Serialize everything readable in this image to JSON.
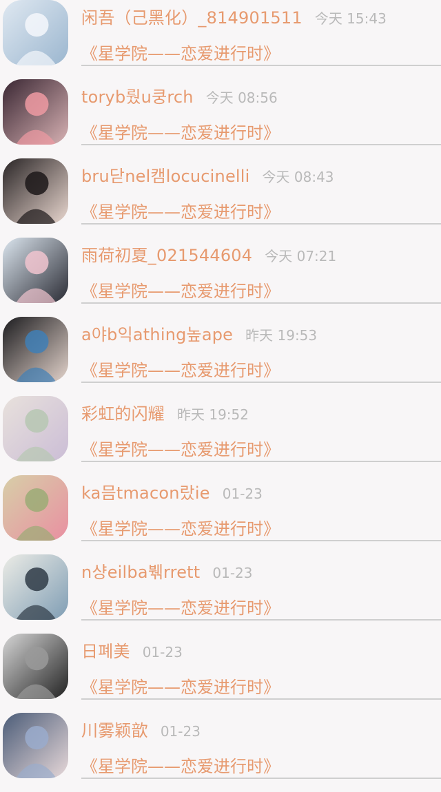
{
  "messages": [
    {
      "name": "闲吾（己黑化）_814901511",
      "time": "今天 15:43",
      "title": "《星学院——恋爱进行时》",
      "avatar": {
        "icon": "avatar-fairy-white-dress",
        "c1": "#dfe8f1",
        "c2": "#9bb6cf",
        "c3": "#f4f7fb"
      }
    },
    {
      "name": "toryb뤘u쿵rch",
      "time": "今天 08:56",
      "title": "《星学院——恋爱进行时》",
      "avatar": {
        "icon": "avatar-hand-flower",
        "c1": "#3a2733",
        "c2": "#d7b1b3",
        "c3": "#ef9aa2"
      }
    },
    {
      "name": "bru닫nel캠locucinelli",
      "time": "今天 08:43",
      "title": "《星学院——恋爱进行时》",
      "avatar": {
        "icon": "avatar-girl-portrait",
        "c1": "#2a2526",
        "c2": "#e9d7cf",
        "c3": "#1c1819"
      }
    },
    {
      "name": "雨荷初夏_021544604",
      "time": "今天 07:21",
      "title": "《星学院——恋爱进行时》",
      "avatar": {
        "icon": "avatar-anime-couple",
        "c1": "#dbe5ee",
        "c2": "#2a2b34",
        "c3": "#f1c4cf"
      }
    },
    {
      "name": "a야b익athing높ape",
      "time": "昨天 19:53",
      "title": "《星学院——恋爱进行时》",
      "avatar": {
        "icon": "avatar-hand-dark",
        "c1": "#1c1c1f",
        "c2": "#e3d3cb",
        "c3": "#3f7fb6"
      }
    },
    {
      "name": "彩虹的闪耀",
      "time": "昨天 19:52",
      "title": "《星学院——恋爱进行时》",
      "avatar": {
        "icon": "avatar-pastel-drawing",
        "c1": "#e8e1dc",
        "c2": "#cbbdd6",
        "c3": "#b6c7b2"
      }
    },
    {
      "name": "ka믐tmacon랐ie",
      "time": "01-23",
      "title": "《星学院——恋爱进行时》",
      "avatar": {
        "icon": "avatar-roses-book",
        "c1": "#d7cfa8",
        "c2": "#e98fa1",
        "c3": "#9bab75"
      }
    },
    {
      "name": "n샹eilba붺rrett",
      "time": "01-23",
      "title": "《星学院——恋爱进行时》",
      "avatar": {
        "icon": "avatar-room-scene",
        "c1": "#ecece6",
        "c2": "#7f9db4",
        "c3": "#2f3b46"
      }
    },
    {
      "name": "日폐美",
      "time": "01-23",
      "title": "《星学院——恋爱进行时》",
      "avatar": {
        "icon": "avatar-boy-bw",
        "c1": "#d6d6d6",
        "c2": "#222222",
        "c3": "#9a9a9a"
      }
    },
    {
      "name": "川雾颖歆",
      "time": "01-23",
      "title": "《星学院——恋爱进行时》",
      "avatar": {
        "icon": "avatar-girl-snow",
        "c1": "#4b5c78",
        "c2": "#e7d8d9",
        "c3": "#9aaccc"
      }
    }
  ]
}
